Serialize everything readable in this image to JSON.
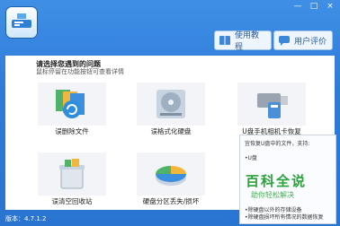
{
  "window": {
    "controls": [
      "—",
      "□",
      "×"
    ]
  },
  "toolbar": {
    "tutorial": "使用教程",
    "review": "用户评价"
  },
  "main": {
    "prompt_title": "请选择您遇到的问题",
    "prompt_hint": "鼠标停留在功能按钮可查看详情",
    "tiles": [
      {
        "label": "误删除文件"
      },
      {
        "label": "误格式化硬盘"
      },
      {
        "label": "U盘手机相机卡恢复"
      },
      {
        "label": "误清空回收站"
      },
      {
        "label": "硬盘分区丢失/损坏"
      }
    ]
  },
  "tooltip": {
    "header": "宜恢复U盘中的文件，支持:",
    "item1": "•U盘",
    "watermark_title": "百科全说",
    "watermark_sub": "助你轻松解决",
    "item2": "•除硬盘以外的存储设备",
    "item3": "•除硬盘损坏所有情况的数据恢复"
  },
  "status": {
    "version": "版本：4.7.1.2"
  },
  "colors": {
    "title_bg": "#2e7bd9",
    "accent_green": "#2aa23a"
  }
}
